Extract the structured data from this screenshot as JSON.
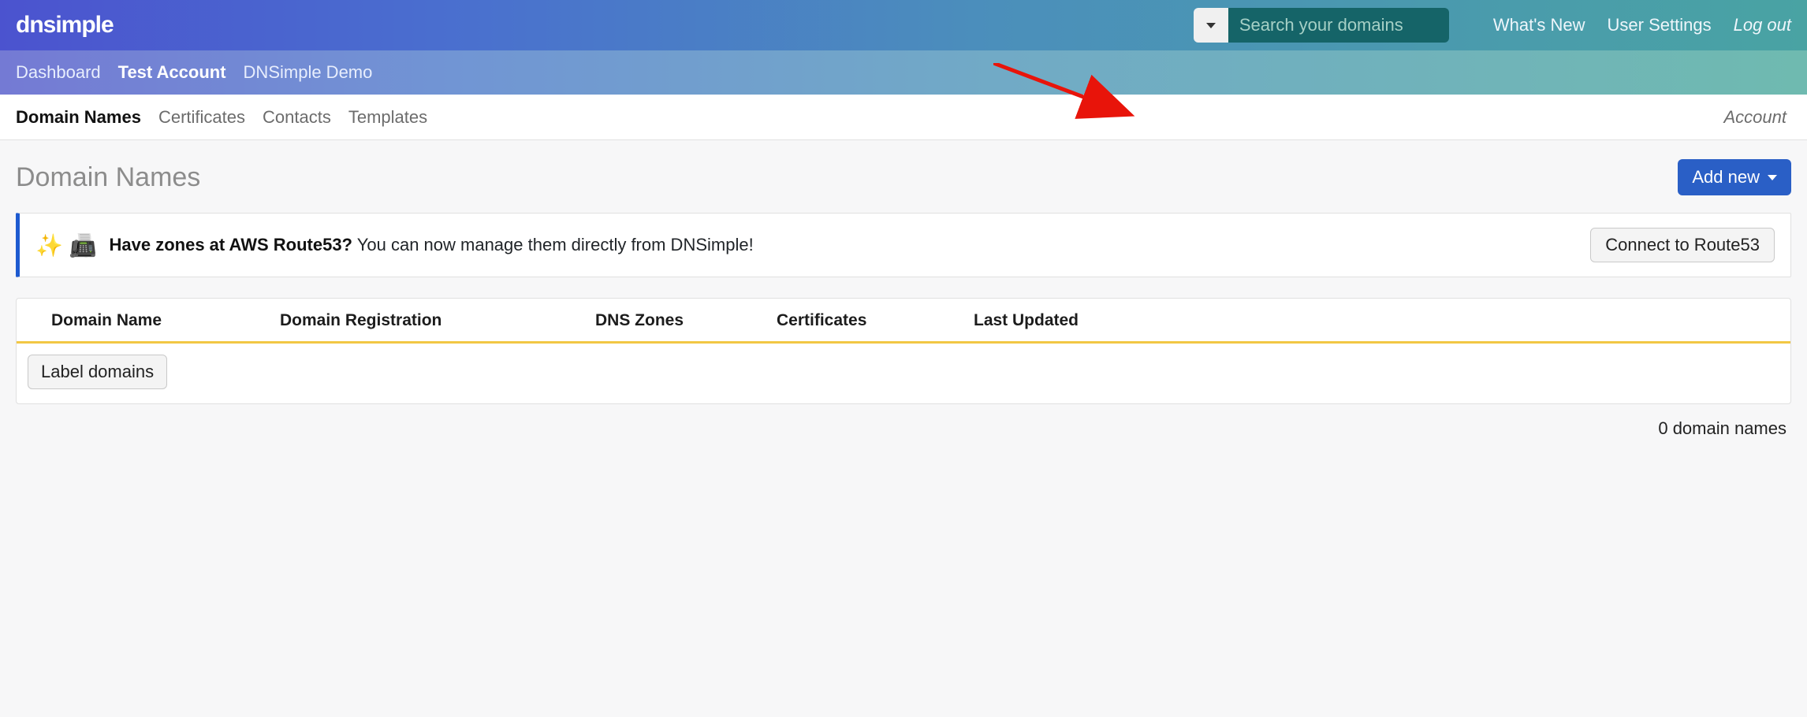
{
  "header": {
    "logo_text": "dnsimple",
    "search": {
      "placeholder": "Search your domains"
    },
    "links": {
      "whats_new": "What's New",
      "user_settings": "User Settings",
      "log_out": "Log out"
    }
  },
  "breadcrumb": {
    "dashboard": "Dashboard",
    "account": "Test Account",
    "context": "DNSimple Demo"
  },
  "subnav": {
    "domain_names": "Domain Names",
    "certificates": "Certificates",
    "contacts": "Contacts",
    "templates": "Templates",
    "account": "Account"
  },
  "page": {
    "title": "Domain Names",
    "add_new_label": "Add new"
  },
  "banner": {
    "emoji": "✨ 📠",
    "bold": "Have zones at AWS Route53?",
    "rest": " You can now manage them directly from DNSimple!",
    "cta": "Connect to Route53"
  },
  "table": {
    "columns": {
      "domain_name": "Domain Name",
      "registration": "Domain Registration",
      "dns_zones": "DNS Zones",
      "certificates": "Certificates",
      "last_updated": "Last Updated"
    },
    "label_domains_btn": "Label domains"
  },
  "footer": {
    "count_text": "0 domain names"
  }
}
